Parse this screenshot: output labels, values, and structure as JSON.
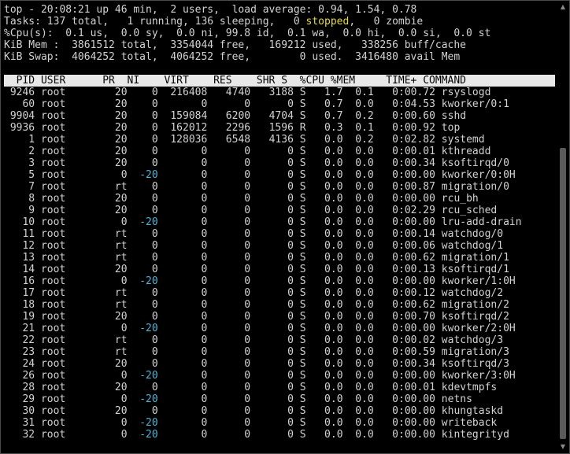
{
  "summary": {
    "line1": "top - 20:08:21 up 46 min,  2 users,  load average: 0.94, 1.54, 0.78",
    "line2_a": "Tasks: 137 total,   1 running, 136 sleeping,   0 ",
    "line2_stopped": "stopped",
    "line2_b": ",   0 zombie",
    "line3": "%Cpu(s):  0.1 us,  0.0 sy,  0.0 ni, 99.8 id,  0.1 wa,  0.0 hi,  0.0 si,  0.0 st",
    "line4": "KiB Mem :  3861512 total,  3354044 free,   169212 used,   338256 buff/cache",
    "line5": "KiB Swap:  4064252 total,  4064252 free,        0 used.  3416480 avail Mem"
  },
  "table": {
    "header": "  PID USER      PR  NI    VIRT    RES    SHR S  %CPU %MEM     TIME+ COMMAND",
    "rows": [
      {
        "pid": "9246",
        "user": "root",
        "pr": "20",
        "ni": "0",
        "virt": "216408",
        "res": "4740",
        "shr": "3188",
        "s": "S",
        "cpu": "1.7",
        "mem": "0.1",
        "time": "0:00.72",
        "command": "rsyslogd"
      },
      {
        "pid": "60",
        "user": "root",
        "pr": "20",
        "ni": "0",
        "virt": "0",
        "res": "0",
        "shr": "0",
        "s": "S",
        "cpu": "0.7",
        "mem": "0.0",
        "time": "0:04.53",
        "command": "kworker/0:1"
      },
      {
        "pid": "9904",
        "user": "root",
        "pr": "20",
        "ni": "0",
        "virt": "159084",
        "res": "6200",
        "shr": "4704",
        "s": "S",
        "cpu": "0.7",
        "mem": "0.2",
        "time": "0:00.60",
        "command": "sshd"
      },
      {
        "pid": "9936",
        "user": "root",
        "pr": "20",
        "ni": "0",
        "virt": "162012",
        "res": "2296",
        "shr": "1596",
        "s": "R",
        "cpu": "0.3",
        "mem": "0.1",
        "time": "0:00.92",
        "command": "top"
      },
      {
        "pid": "1",
        "user": "root",
        "pr": "20",
        "ni": "0",
        "virt": "128036",
        "res": "6548",
        "shr": "4136",
        "s": "S",
        "cpu": "0.0",
        "mem": "0.2",
        "time": "0:02.82",
        "command": "systemd"
      },
      {
        "pid": "2",
        "user": "root",
        "pr": "20",
        "ni": "0",
        "virt": "0",
        "res": "0",
        "shr": "0",
        "s": "S",
        "cpu": "0.0",
        "mem": "0.0",
        "time": "0:00.01",
        "command": "kthreadd"
      },
      {
        "pid": "3",
        "user": "root",
        "pr": "20",
        "ni": "0",
        "virt": "0",
        "res": "0",
        "shr": "0",
        "s": "S",
        "cpu": "0.0",
        "mem": "0.0",
        "time": "0:00.34",
        "command": "ksoftirqd/0"
      },
      {
        "pid": "5",
        "user": "root",
        "pr": "0",
        "ni": "-20",
        "virt": "0",
        "res": "0",
        "shr": "0",
        "s": "S",
        "cpu": "0.0",
        "mem": "0.0",
        "time": "0:00.00",
        "command": "kworker/0:0H"
      },
      {
        "pid": "7",
        "user": "root",
        "pr": "rt",
        "ni": "0",
        "virt": "0",
        "res": "0",
        "shr": "0",
        "s": "S",
        "cpu": "0.0",
        "mem": "0.0",
        "time": "0:00.87",
        "command": "migration/0"
      },
      {
        "pid": "8",
        "user": "root",
        "pr": "20",
        "ni": "0",
        "virt": "0",
        "res": "0",
        "shr": "0",
        "s": "S",
        "cpu": "0.0",
        "mem": "0.0",
        "time": "0:00.00",
        "command": "rcu_bh"
      },
      {
        "pid": "9",
        "user": "root",
        "pr": "20",
        "ni": "0",
        "virt": "0",
        "res": "0",
        "shr": "0",
        "s": "S",
        "cpu": "0.0",
        "mem": "0.0",
        "time": "0:02.29",
        "command": "rcu_sched"
      },
      {
        "pid": "10",
        "user": "root",
        "pr": "0",
        "ni": "-20",
        "virt": "0",
        "res": "0",
        "shr": "0",
        "s": "S",
        "cpu": "0.0",
        "mem": "0.0",
        "time": "0:00.00",
        "command": "lru-add-drain"
      },
      {
        "pid": "11",
        "user": "root",
        "pr": "rt",
        "ni": "0",
        "virt": "0",
        "res": "0",
        "shr": "0",
        "s": "S",
        "cpu": "0.0",
        "mem": "0.0",
        "time": "0:00.14",
        "command": "watchdog/0"
      },
      {
        "pid": "12",
        "user": "root",
        "pr": "rt",
        "ni": "0",
        "virt": "0",
        "res": "0",
        "shr": "0",
        "s": "S",
        "cpu": "0.0",
        "mem": "0.0",
        "time": "0:00.06",
        "command": "watchdog/1"
      },
      {
        "pid": "13",
        "user": "root",
        "pr": "rt",
        "ni": "0",
        "virt": "0",
        "res": "0",
        "shr": "0",
        "s": "S",
        "cpu": "0.0",
        "mem": "0.0",
        "time": "0:00.62",
        "command": "migration/1"
      },
      {
        "pid": "14",
        "user": "root",
        "pr": "20",
        "ni": "0",
        "virt": "0",
        "res": "0",
        "shr": "0",
        "s": "S",
        "cpu": "0.0",
        "mem": "0.0",
        "time": "0:00.13",
        "command": "ksoftirqd/1"
      },
      {
        "pid": "16",
        "user": "root",
        "pr": "0",
        "ni": "-20",
        "virt": "0",
        "res": "0",
        "shr": "0",
        "s": "S",
        "cpu": "0.0",
        "mem": "0.0",
        "time": "0:00.00",
        "command": "kworker/1:0H"
      },
      {
        "pid": "17",
        "user": "root",
        "pr": "rt",
        "ni": "0",
        "virt": "0",
        "res": "0",
        "shr": "0",
        "s": "S",
        "cpu": "0.0",
        "mem": "0.0",
        "time": "0:00.12",
        "command": "watchdog/2"
      },
      {
        "pid": "18",
        "user": "root",
        "pr": "rt",
        "ni": "0",
        "virt": "0",
        "res": "0",
        "shr": "0",
        "s": "S",
        "cpu": "0.0",
        "mem": "0.0",
        "time": "0:00.62",
        "command": "migration/2"
      },
      {
        "pid": "19",
        "user": "root",
        "pr": "20",
        "ni": "0",
        "virt": "0",
        "res": "0",
        "shr": "0",
        "s": "S",
        "cpu": "0.0",
        "mem": "0.0",
        "time": "0:00.70",
        "command": "ksoftirqd/2"
      },
      {
        "pid": "21",
        "user": "root",
        "pr": "0",
        "ni": "-20",
        "virt": "0",
        "res": "0",
        "shr": "0",
        "s": "S",
        "cpu": "0.0",
        "mem": "0.0",
        "time": "0:00.00",
        "command": "kworker/2:0H"
      },
      {
        "pid": "22",
        "user": "root",
        "pr": "rt",
        "ni": "0",
        "virt": "0",
        "res": "0",
        "shr": "0",
        "s": "S",
        "cpu": "0.0",
        "mem": "0.0",
        "time": "0:00.02",
        "command": "watchdog/3"
      },
      {
        "pid": "23",
        "user": "root",
        "pr": "rt",
        "ni": "0",
        "virt": "0",
        "res": "0",
        "shr": "0",
        "s": "S",
        "cpu": "0.0",
        "mem": "0.0",
        "time": "0:00.59",
        "command": "migration/3"
      },
      {
        "pid": "24",
        "user": "root",
        "pr": "20",
        "ni": "0",
        "virt": "0",
        "res": "0",
        "shr": "0",
        "s": "S",
        "cpu": "0.0",
        "mem": "0.0",
        "time": "0:00.34",
        "command": "ksoftirqd/3"
      },
      {
        "pid": "26",
        "user": "root",
        "pr": "0",
        "ni": "-20",
        "virt": "0",
        "res": "0",
        "shr": "0",
        "s": "S",
        "cpu": "0.0",
        "mem": "0.0",
        "time": "0:00.00",
        "command": "kworker/3:0H"
      },
      {
        "pid": "28",
        "user": "root",
        "pr": "20",
        "ni": "0",
        "virt": "0",
        "res": "0",
        "shr": "0",
        "s": "S",
        "cpu": "0.0",
        "mem": "0.0",
        "time": "0:00.01",
        "command": "kdevtmpfs"
      },
      {
        "pid": "29",
        "user": "root",
        "pr": "0",
        "ni": "-20",
        "virt": "0",
        "res": "0",
        "shr": "0",
        "s": "S",
        "cpu": "0.0",
        "mem": "0.0",
        "time": "0:00.00",
        "command": "netns"
      },
      {
        "pid": "30",
        "user": "root",
        "pr": "20",
        "ni": "0",
        "virt": "0",
        "res": "0",
        "shr": "0",
        "s": "S",
        "cpu": "0.0",
        "mem": "0.0",
        "time": "0:00.00",
        "command": "khungtaskd"
      },
      {
        "pid": "31",
        "user": "root",
        "pr": "0",
        "ni": "-20",
        "virt": "0",
        "res": "0",
        "shr": "0",
        "s": "S",
        "cpu": "0.0",
        "mem": "0.0",
        "time": "0:00.00",
        "command": "writeback"
      },
      {
        "pid": "32",
        "user": "root",
        "pr": "0",
        "ni": "-20",
        "virt": "0",
        "res": "0",
        "shr": "0",
        "s": "S",
        "cpu": "0.0",
        "mem": "0.0",
        "time": "0:00.00",
        "command": "kintegrityd"
      }
    ]
  },
  "scrollbar": {
    "up_icon": "▲",
    "down_icon": "▼"
  },
  "colors": {
    "background": "#000000",
    "text": "#d2d2d2",
    "stopped_highlight": "#e6db3c",
    "negative_nice": "#4fb2d6",
    "header_bg": "#e8e8e8"
  }
}
